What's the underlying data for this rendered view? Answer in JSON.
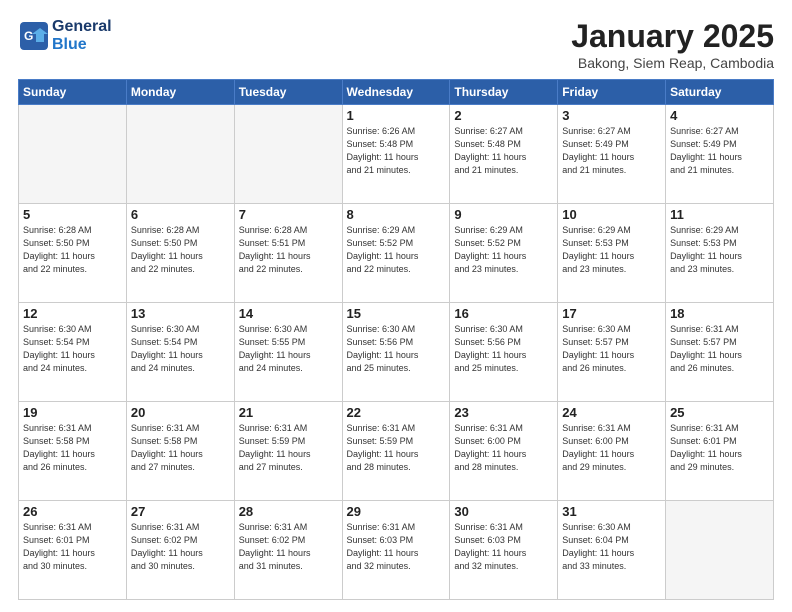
{
  "header": {
    "logo_line1": "General",
    "logo_line2": "Blue",
    "title": "January 2025",
    "subtitle": "Bakong, Siem Reap, Cambodia"
  },
  "days_of_week": [
    "Sunday",
    "Monday",
    "Tuesday",
    "Wednesday",
    "Thursday",
    "Friday",
    "Saturday"
  ],
  "weeks": [
    [
      {
        "day": "",
        "info": ""
      },
      {
        "day": "",
        "info": ""
      },
      {
        "day": "",
        "info": ""
      },
      {
        "day": "1",
        "info": "Sunrise: 6:26 AM\nSunset: 5:48 PM\nDaylight: 11 hours\nand 21 minutes."
      },
      {
        "day": "2",
        "info": "Sunrise: 6:27 AM\nSunset: 5:48 PM\nDaylight: 11 hours\nand 21 minutes."
      },
      {
        "day": "3",
        "info": "Sunrise: 6:27 AM\nSunset: 5:49 PM\nDaylight: 11 hours\nand 21 minutes."
      },
      {
        "day": "4",
        "info": "Sunrise: 6:27 AM\nSunset: 5:49 PM\nDaylight: 11 hours\nand 21 minutes."
      }
    ],
    [
      {
        "day": "5",
        "info": "Sunrise: 6:28 AM\nSunset: 5:50 PM\nDaylight: 11 hours\nand 22 minutes."
      },
      {
        "day": "6",
        "info": "Sunrise: 6:28 AM\nSunset: 5:50 PM\nDaylight: 11 hours\nand 22 minutes."
      },
      {
        "day": "7",
        "info": "Sunrise: 6:28 AM\nSunset: 5:51 PM\nDaylight: 11 hours\nand 22 minutes."
      },
      {
        "day": "8",
        "info": "Sunrise: 6:29 AM\nSunset: 5:52 PM\nDaylight: 11 hours\nand 22 minutes."
      },
      {
        "day": "9",
        "info": "Sunrise: 6:29 AM\nSunset: 5:52 PM\nDaylight: 11 hours\nand 23 minutes."
      },
      {
        "day": "10",
        "info": "Sunrise: 6:29 AM\nSunset: 5:53 PM\nDaylight: 11 hours\nand 23 minutes."
      },
      {
        "day": "11",
        "info": "Sunrise: 6:29 AM\nSunset: 5:53 PM\nDaylight: 11 hours\nand 23 minutes."
      }
    ],
    [
      {
        "day": "12",
        "info": "Sunrise: 6:30 AM\nSunset: 5:54 PM\nDaylight: 11 hours\nand 24 minutes."
      },
      {
        "day": "13",
        "info": "Sunrise: 6:30 AM\nSunset: 5:54 PM\nDaylight: 11 hours\nand 24 minutes."
      },
      {
        "day": "14",
        "info": "Sunrise: 6:30 AM\nSunset: 5:55 PM\nDaylight: 11 hours\nand 24 minutes."
      },
      {
        "day": "15",
        "info": "Sunrise: 6:30 AM\nSunset: 5:56 PM\nDaylight: 11 hours\nand 25 minutes."
      },
      {
        "day": "16",
        "info": "Sunrise: 6:30 AM\nSunset: 5:56 PM\nDaylight: 11 hours\nand 25 minutes."
      },
      {
        "day": "17",
        "info": "Sunrise: 6:30 AM\nSunset: 5:57 PM\nDaylight: 11 hours\nand 26 minutes."
      },
      {
        "day": "18",
        "info": "Sunrise: 6:31 AM\nSunset: 5:57 PM\nDaylight: 11 hours\nand 26 minutes."
      }
    ],
    [
      {
        "day": "19",
        "info": "Sunrise: 6:31 AM\nSunset: 5:58 PM\nDaylight: 11 hours\nand 26 minutes."
      },
      {
        "day": "20",
        "info": "Sunrise: 6:31 AM\nSunset: 5:58 PM\nDaylight: 11 hours\nand 27 minutes."
      },
      {
        "day": "21",
        "info": "Sunrise: 6:31 AM\nSunset: 5:59 PM\nDaylight: 11 hours\nand 27 minutes."
      },
      {
        "day": "22",
        "info": "Sunrise: 6:31 AM\nSunset: 5:59 PM\nDaylight: 11 hours\nand 28 minutes."
      },
      {
        "day": "23",
        "info": "Sunrise: 6:31 AM\nSunset: 6:00 PM\nDaylight: 11 hours\nand 28 minutes."
      },
      {
        "day": "24",
        "info": "Sunrise: 6:31 AM\nSunset: 6:00 PM\nDaylight: 11 hours\nand 29 minutes."
      },
      {
        "day": "25",
        "info": "Sunrise: 6:31 AM\nSunset: 6:01 PM\nDaylight: 11 hours\nand 29 minutes."
      }
    ],
    [
      {
        "day": "26",
        "info": "Sunrise: 6:31 AM\nSunset: 6:01 PM\nDaylight: 11 hours\nand 30 minutes."
      },
      {
        "day": "27",
        "info": "Sunrise: 6:31 AM\nSunset: 6:02 PM\nDaylight: 11 hours\nand 30 minutes."
      },
      {
        "day": "28",
        "info": "Sunrise: 6:31 AM\nSunset: 6:02 PM\nDaylight: 11 hours\nand 31 minutes."
      },
      {
        "day": "29",
        "info": "Sunrise: 6:31 AM\nSunset: 6:03 PM\nDaylight: 11 hours\nand 32 minutes."
      },
      {
        "day": "30",
        "info": "Sunrise: 6:31 AM\nSunset: 6:03 PM\nDaylight: 11 hours\nand 32 minutes."
      },
      {
        "day": "31",
        "info": "Sunrise: 6:30 AM\nSunset: 6:04 PM\nDaylight: 11 hours\nand 33 minutes."
      },
      {
        "day": "",
        "info": ""
      }
    ]
  ]
}
